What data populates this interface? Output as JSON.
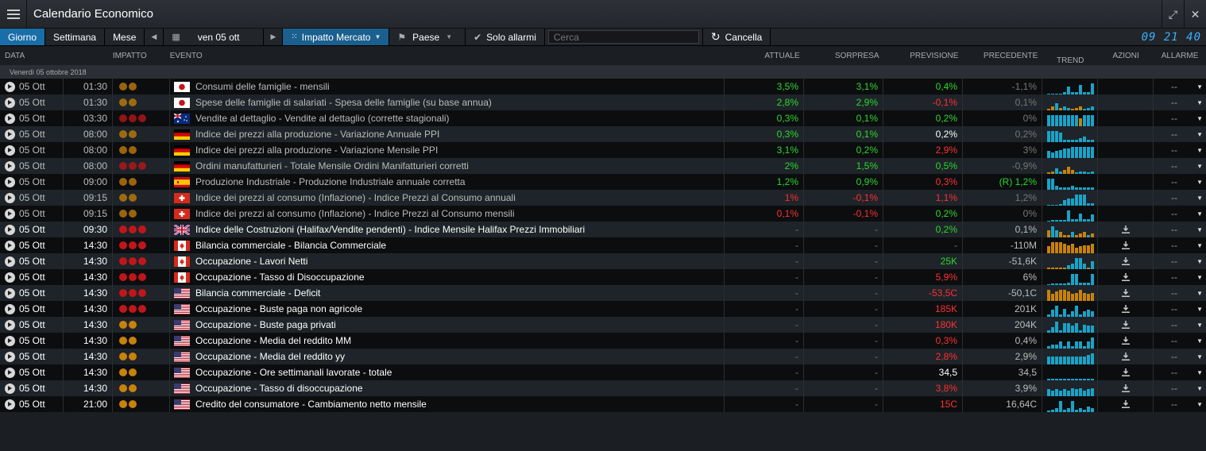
{
  "window": {
    "title": "Calendario Economico"
  },
  "toolbar": {
    "day": "Giorno",
    "week": "Settimana",
    "month": "Mese",
    "date": "ven 05 ott",
    "impact": "Impatto Mercato",
    "country": "Paese",
    "alarms": "Solo allarmi",
    "search_placeholder": "Cerca",
    "cancel": "Cancella",
    "clock": "09 21 40"
  },
  "columns": [
    "DATA",
    "IMPATTO",
    "EVENTO",
    "ATTUALE",
    "SORPRESA",
    "PREVISIONE",
    "PRECEDENTE",
    "TREND",
    "AZIONI",
    "ALLARME"
  ],
  "group": "Venerdì 05 ottobre 2018",
  "colors": {
    "orange": "#c8820a",
    "red": "#c0161a",
    "pos": "#2bd92b",
    "neg": "#ff3030",
    "teal": "#1aa3c8",
    "accent": "#1a6ea8"
  },
  "rows": [
    {
      "date": "05 Ott",
      "time": "01:30",
      "impact": [
        "o",
        "o"
      ],
      "flag": "jp",
      "event": "Consumi delle famiglie - mensili",
      "actual": "3,5%",
      "actual_c": "pos",
      "surprise": "3,1%",
      "surprise_c": "pos",
      "forecast": "0,4%",
      "forecast_c": "pos",
      "previous": "-1,1%",
      "previous_c": "dim",
      "trend": [
        0,
        0,
        0,
        0,
        0.2,
        0.6,
        0.2,
        0.2,
        0.7,
        0.2,
        0.2,
        0.8
      ],
      "trend_c": "tttttttttttt",
      "past": true,
      "dl": false
    },
    {
      "date": "05 Ott",
      "time": "01:30",
      "impact": [
        "o",
        "o"
      ],
      "flag": "jp",
      "event": "Spese delle famiglie di salariati - Spesa delle famiglie (su base annua)",
      "actual": "2,8%",
      "actual_c": "pos",
      "surprise": "2,9%",
      "surprise_c": "pos",
      "forecast": "-0,1%",
      "forecast_c": "neg",
      "previous": "0,1%",
      "previous_c": "dim",
      "trend": [
        0.1,
        0.3,
        0.5,
        0.2,
        0.3,
        0.2,
        0.1,
        0.2,
        0.3,
        0.1,
        0.2,
        0.3
      ],
      "trend_c": "ootottooottt",
      "past": true,
      "dl": false
    },
    {
      "date": "05 Ott",
      "time": "03:30",
      "impact": [
        "r",
        "r",
        "r"
      ],
      "flag": "au",
      "event": "Vendite al dettaglio - Vendite al dettaglio (corrette stagionali)",
      "actual": "0,3%",
      "actual_c": "pos",
      "surprise": "0,1%",
      "surprise_c": "pos",
      "forecast": "0,2%",
      "forecast_c": "pos",
      "previous": "0%",
      "previous_c": "dim",
      "trend": [
        0.8,
        0.8,
        0.8,
        0.8,
        0.8,
        0.8,
        0.8,
        0.8,
        0.6,
        0.8,
        0.8,
        0.8
      ],
      "trend_c": "ttttttttottt",
      "past": true,
      "dl": false
    },
    {
      "date": "05 Ott",
      "time": "08:00",
      "impact": [
        "o",
        "o"
      ],
      "flag": "de",
      "event": "Indice dei prezzi alla produzione - Variazione Annuale PPI",
      "actual": "0,3%",
      "actual_c": "pos",
      "surprise": "0,1%",
      "surprise_c": "pos",
      "forecast": "0,2%",
      "forecast_c": "neu",
      "previous": "0,2%",
      "previous_c": "dim",
      "trend": [
        0.8,
        0.8,
        0.8,
        0.7,
        0.2,
        0.2,
        0.2,
        0.2,
        0.3,
        0.4,
        0.2,
        0.2
      ],
      "trend_c": "tttttttttttt",
      "past": true,
      "dl": false
    },
    {
      "date": "05 Ott",
      "time": "08:00",
      "impact": [
        "o",
        "o"
      ],
      "flag": "de",
      "event": "Indice dei prezzi alla produzione - Variazione Mensile PPI",
      "actual": "3,1%",
      "actual_c": "pos",
      "surprise": "0,2%",
      "surprise_c": "pos",
      "forecast": "2,9%",
      "forecast_c": "neg",
      "previous": "3%",
      "previous_c": "dim",
      "trend": [
        0.5,
        0.4,
        0.5,
        0.6,
        0.7,
        0.7,
        0.8,
        0.8,
        0.8,
        0.8,
        0.8,
        0.8
      ],
      "trend_c": "tttttttttttt",
      "past": true,
      "dl": false
    },
    {
      "date": "05 Ott",
      "time": "08:00",
      "impact": [
        "r",
        "r",
        "r"
      ],
      "flag": "de",
      "event": "Ordini manufatturieri - Totale Mensile Ordini Manifatturieri corretti",
      "actual": "2%",
      "actual_c": "pos",
      "surprise": "1,5%",
      "surprise_c": "pos",
      "forecast": "0,5%",
      "forecast_c": "pos",
      "previous": "-0,9%",
      "previous_c": "dim",
      "trend": [
        0.1,
        0.2,
        0.4,
        0.2,
        0.3,
        0.5,
        0.3,
        0.1,
        0.2,
        0.2,
        0.1,
        0.2
      ],
      "trend_c": "oottooottttt",
      "past": true,
      "dl": false
    },
    {
      "date": "05 Ott",
      "time": "09:00",
      "impact": [
        "o",
        "o"
      ],
      "flag": "es",
      "event": "Produzione Industriale - Produzione Industriale annuale corretta",
      "actual": "1,2%",
      "actual_c": "pos",
      "surprise": "0,9%",
      "surprise_c": "pos",
      "forecast": "0,3%",
      "forecast_c": "neg",
      "previous": "(R) 1,2%",
      "previous_c": "pos",
      "trend": [
        0.8,
        0.8,
        0.3,
        0.2,
        0.2,
        0.2,
        0.3,
        0.2,
        0.2,
        0.2,
        0.2,
        0.2
      ],
      "trend_c": "tttttttttttt",
      "past": true,
      "dl": false
    },
    {
      "date": "05 Ott",
      "time": "09:15",
      "impact": [
        "o",
        "o"
      ],
      "flag": "ch",
      "event": "Indice dei prezzi al consumo (Inflazione) - Indice Prezzi al Consumo annuali",
      "actual": "1%",
      "actual_c": "neg",
      "surprise": "-0,1%",
      "surprise_c": "neg",
      "forecast": "1,1%",
      "forecast_c": "neg",
      "previous": "1,2%",
      "previous_c": "dim",
      "trend": [
        0,
        0,
        0,
        0.1,
        0.4,
        0.5,
        0.5,
        0.8,
        0.8,
        0.8,
        0.2,
        0.2
      ],
      "trend_c": "tttttttttttt",
      "past": true,
      "dl": false
    },
    {
      "date": "05 Ott",
      "time": "09:15",
      "impact": [
        "o",
        "o"
      ],
      "flag": "ch",
      "event": "Indice dei prezzi al consumo (Inflazione) - Indice Prezzi al Consumo mensili",
      "actual": "0,1%",
      "actual_c": "neg",
      "surprise": "-0,1%",
      "surprise_c": "neg",
      "forecast": "0,2%",
      "forecast_c": "pos",
      "previous": "0%",
      "previous_c": "dim",
      "trend": [
        0,
        0.1,
        0.1,
        0.1,
        0.1,
        0.8,
        0.2,
        0.2,
        0.6,
        0.2,
        0.2,
        0.5
      ],
      "trend_c": "tttttttttttt",
      "past": true,
      "dl": false
    },
    {
      "date": "05 Ott",
      "time": "09:30",
      "impact": [
        "r",
        "r",
        "r"
      ],
      "flag": "gb",
      "event": "Indice delle Costruzioni (Halifax/Vendite pendenti) - Indice Mensile Halifax Prezzi Immobiliari",
      "actual": "-",
      "actual_c": "dim",
      "surprise": "-",
      "surprise_c": "dim",
      "forecast": "0,2%",
      "forecast_c": "pos",
      "previous": "0,1%",
      "previous_c": "past",
      "trend": [
        0.5,
        0.8,
        0.5,
        0.4,
        0.2,
        0.2,
        0.4,
        0.2,
        0.3,
        0.4,
        0.2,
        0.3
      ],
      "trend_c": "ottoootoooto",
      "past": false,
      "dl": true
    },
    {
      "date": "05 Ott",
      "time": "14:30",
      "impact": [
        "r",
        "r",
        "r"
      ],
      "flag": "ca",
      "event": "Bilancia commerciale - Bilancia Commerciale",
      "actual": "-",
      "actual_c": "dim",
      "surprise": "-",
      "surprise_c": "dim",
      "forecast": "-",
      "forecast_c": "dim",
      "previous": "-110M",
      "previous_c": "past",
      "trend": [
        0.5,
        0.8,
        0.8,
        0.8,
        0.7,
        0.6,
        0.7,
        0.4,
        0.5,
        0.6,
        0.6,
        0.7
      ],
      "trend_c": "oooooooooooo",
      "past": false,
      "dl": true
    },
    {
      "date": "05 Ott",
      "time": "14:30",
      "impact": [
        "r",
        "r",
        "r"
      ],
      "flag": "ca",
      "event": "Occupazione - Lavori Netti",
      "actual": "-",
      "actual_c": "dim",
      "surprise": "-",
      "surprise_c": "dim",
      "forecast": "25K",
      "forecast_c": "pos",
      "previous": "-51,6K",
      "previous_c": "past",
      "trend": [
        0.1,
        0.1,
        0.1,
        0.1,
        0.1,
        0.3,
        0.4,
        0.8,
        0.8,
        0.4,
        0.1,
        0.6
      ],
      "trend_c": "oooootttttot",
      "past": false,
      "dl": true
    },
    {
      "date": "05 Ott",
      "time": "14:30",
      "impact": [
        "r",
        "r",
        "r"
      ],
      "flag": "ca",
      "event": "Occupazione - Tasso di Disoccupazione",
      "actual": "-",
      "actual_c": "dim",
      "surprise": "-",
      "surprise_c": "dim",
      "forecast": "5,9%",
      "forecast_c": "neg",
      "previous": "6%",
      "previous_c": "past",
      "trend": [
        0,
        0.1,
        0.1,
        0.1,
        0.1,
        0.2,
        0.8,
        0.8,
        0.2,
        0.2,
        0.2,
        0.8
      ],
      "trend_c": "tttttttttttt",
      "past": false,
      "dl": true
    },
    {
      "date": "05 Ott",
      "time": "14:30",
      "impact": [
        "r",
        "r",
        "r"
      ],
      "flag": "us",
      "event": "Bilancia commerciale - Deficit",
      "actual": "-",
      "actual_c": "dim",
      "surprise": "-",
      "surprise_c": "dim",
      "forecast": "-53,5C",
      "forecast_c": "neg",
      "previous": "-50,1C",
      "previous_c": "past",
      "trend": [
        0.8,
        0.5,
        0.7,
        0.8,
        0.8,
        0.7,
        0.5,
        0.6,
        0.8,
        0.6,
        0.5,
        0.6
      ],
      "trend_c": "oooooooooooo",
      "past": false,
      "dl": true
    },
    {
      "date": "05 Ott",
      "time": "14:30",
      "impact": [
        "r",
        "r",
        "r"
      ],
      "flag": "us",
      "event": "Occupazione - Buste paga non agricole",
      "actual": "-",
      "actual_c": "dim",
      "surprise": "-",
      "surprise_c": "dim",
      "forecast": "185K",
      "forecast_c": "neg",
      "previous": "201K",
      "previous_c": "past",
      "trend": [
        0.2,
        0.5,
        0.8,
        0.2,
        0.6,
        0.2,
        0.4,
        0.8,
        0.2,
        0.4,
        0.5,
        0.4
      ],
      "trend_c": "tttttttttttt",
      "past": false,
      "dl": true
    },
    {
      "date": "05 Ott",
      "time": "14:30",
      "impact": [
        "o",
        "o"
      ],
      "flag": "us",
      "event": "Occupazione - Buste paga privati",
      "actual": "-",
      "actual_c": "dim",
      "surprise": "-",
      "surprise_c": "dim",
      "forecast": "180K",
      "forecast_c": "neg",
      "previous": "204K",
      "previous_c": "past",
      "trend": [
        0.2,
        0.4,
        0.8,
        0.2,
        0.7,
        0.7,
        0.5,
        0.7,
        0.2,
        0.6,
        0.5,
        0.5
      ],
      "trend_c": "tttttttttttt",
      "past": false,
      "dl": true
    },
    {
      "date": "05 Ott",
      "time": "14:30",
      "impact": [
        "o",
        "o"
      ],
      "flag": "us",
      "event": "Occupazione - Media del reddito MM",
      "actual": "-",
      "actual_c": "dim",
      "surprise": "-",
      "surprise_c": "dim",
      "forecast": "0,3%",
      "forecast_c": "neg",
      "previous": "0,4%",
      "previous_c": "past",
      "trend": [
        0.2,
        0.3,
        0.3,
        0.5,
        0.2,
        0.5,
        0.2,
        0.5,
        0.5,
        0.2,
        0.5,
        0.8
      ],
      "trend_c": "tttttttttttt",
      "past": false,
      "dl": true
    },
    {
      "date": "05 Ott",
      "time": "14:30",
      "impact": [
        "o",
        "o"
      ],
      "flag": "us",
      "event": "Occupazione - Media del reddito yy",
      "actual": "-",
      "actual_c": "dim",
      "surprise": "-",
      "surprise_c": "dim",
      "forecast": "2,8%",
      "forecast_c": "neg",
      "previous": "2,9%",
      "previous_c": "past",
      "trend": [
        0.6,
        0.6,
        0.6,
        0.6,
        0.6,
        0.6,
        0.6,
        0.6,
        0.6,
        0.6,
        0.7,
        0.8
      ],
      "trend_c": "tttttttttttt",
      "past": false,
      "dl": true
    },
    {
      "date": "05 Ott",
      "time": "14:30",
      "impact": [
        "o",
        "o"
      ],
      "flag": "us",
      "event": "Occupazione - Ore settimanali lavorate - totale",
      "actual": "-",
      "actual_c": "dim",
      "surprise": "-",
      "surprise_c": "dim",
      "forecast": "34,5",
      "forecast_c": "neu",
      "previous": "34,5",
      "previous_c": "past",
      "trend": [
        0.1,
        0.1,
        0.1,
        0.1,
        0.1,
        0.1,
        0.1,
        0.1,
        0.1,
        0.1,
        0.1,
        0.1
      ],
      "trend_c": "tttttttttttt",
      "past": false,
      "dl": true
    },
    {
      "date": "05 Ott",
      "time": "14:30",
      "impact": [
        "o",
        "o"
      ],
      "flag": "us",
      "event": "Occupazione - Tasso di disoccupazione",
      "actual": "-",
      "actual_c": "dim",
      "surprise": "-",
      "surprise_c": "dim",
      "forecast": "3,8%",
      "forecast_c": "neg",
      "previous": "3,9%",
      "previous_c": "past",
      "trend": [
        0.5,
        0.4,
        0.5,
        0.4,
        0.5,
        0.4,
        0.6,
        0.5,
        0.6,
        0.4,
        0.5,
        0.6
      ],
      "trend_c": "tttttttttttt",
      "past": false,
      "dl": true
    },
    {
      "date": "05 Ott",
      "time": "21:00",
      "impact": [
        "o",
        "o"
      ],
      "flag": "us",
      "event": "Credito del consumatore - Cambiamento netto mensile",
      "actual": "-",
      "actual_c": "dim",
      "surprise": "-",
      "surprise_c": "dim",
      "forecast": "15C",
      "forecast_c": "neg",
      "previous": "16,64C",
      "previous_c": "past",
      "trend": [
        0.1,
        0.2,
        0.3,
        0.8,
        0.2,
        0.3,
        0.8,
        0.2,
        0.3,
        0.2,
        0.4,
        0.3
      ],
      "trend_c": "tttttttttttt",
      "past": false,
      "dl": true
    }
  ],
  "alarm_value": "--"
}
